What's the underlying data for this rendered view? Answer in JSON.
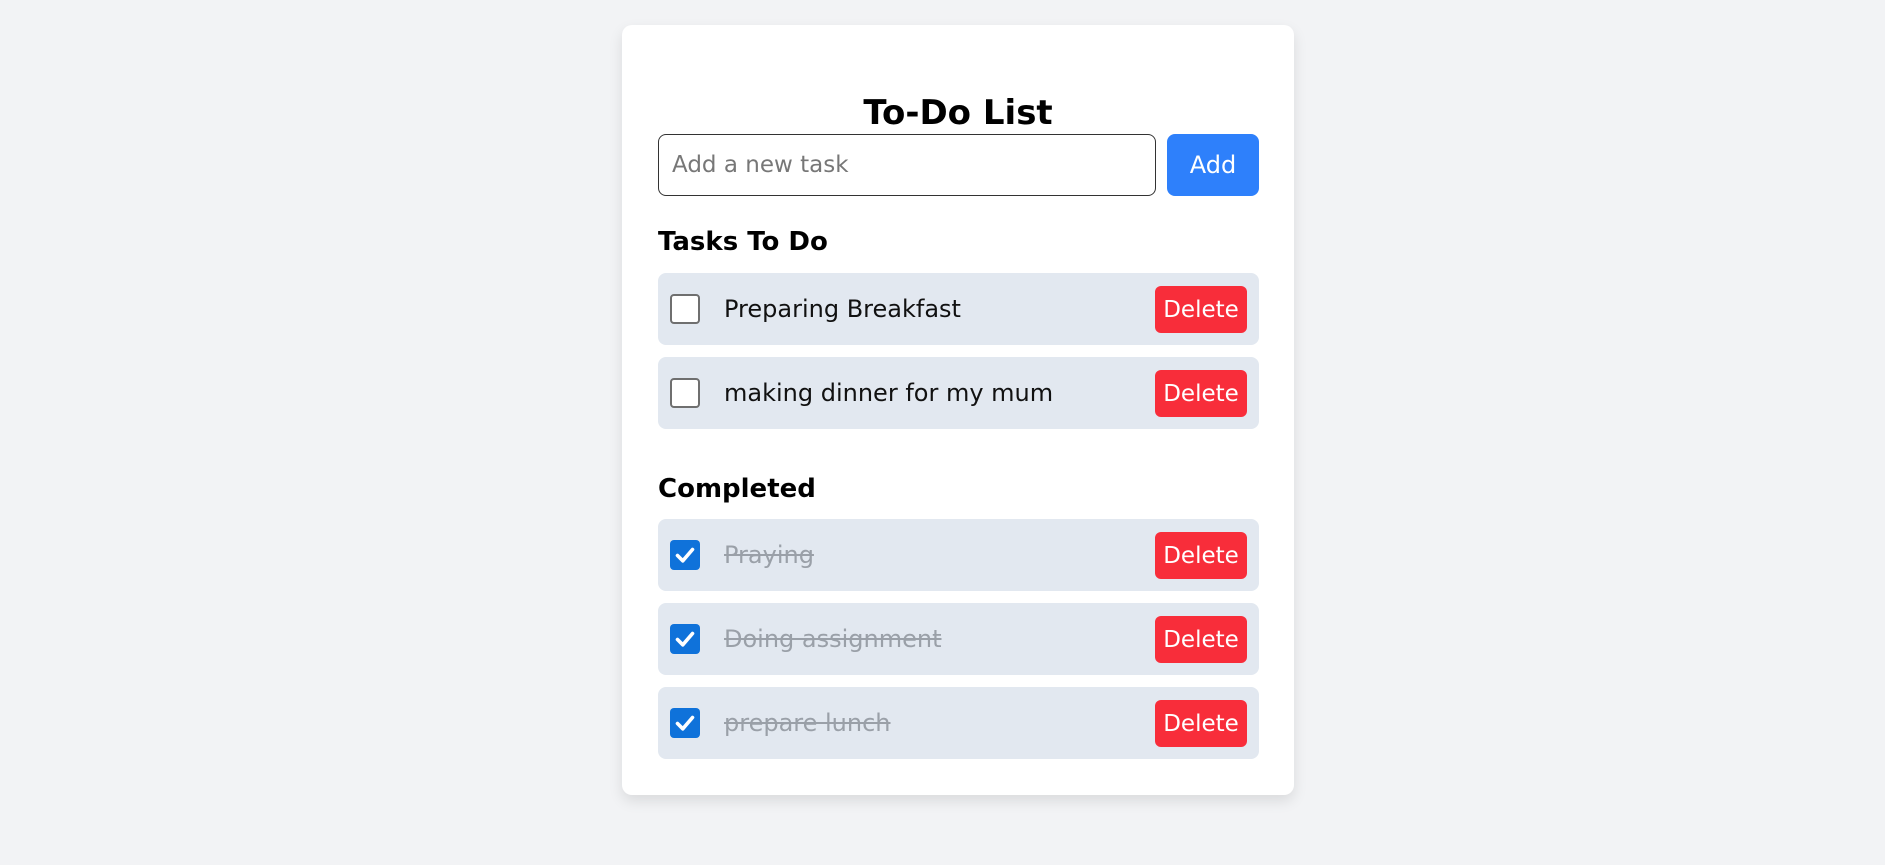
{
  "app": {
    "title": "To-Do List"
  },
  "new_task": {
    "placeholder": "Add a new task",
    "value": "",
    "add_label": "Add"
  },
  "todo": {
    "heading": "Tasks To Do",
    "tasks": [
      {
        "text": "Preparing Breakfast",
        "checked": false,
        "delete_label": "Delete"
      },
      {
        "text": "making dinner for my mum",
        "checked": false,
        "delete_label": "Delete"
      }
    ]
  },
  "completed": {
    "heading": "Completed",
    "tasks": [
      {
        "text": "Praying",
        "checked": true,
        "delete_label": "Delete"
      },
      {
        "text": "Doing assignment",
        "checked": true,
        "delete_label": "Delete"
      },
      {
        "text": "prepare lunch",
        "checked": true,
        "delete_label": "Delete"
      }
    ]
  },
  "colors": {
    "page_background": "#f2f3f5",
    "card_background": "#ffffff",
    "add_button": "#2e80fb",
    "delete_button": "#f82d3a",
    "task_row": "#e2e8f0",
    "checkbox_checked": "#0f72da",
    "completed_text": "#9aa0a8"
  }
}
